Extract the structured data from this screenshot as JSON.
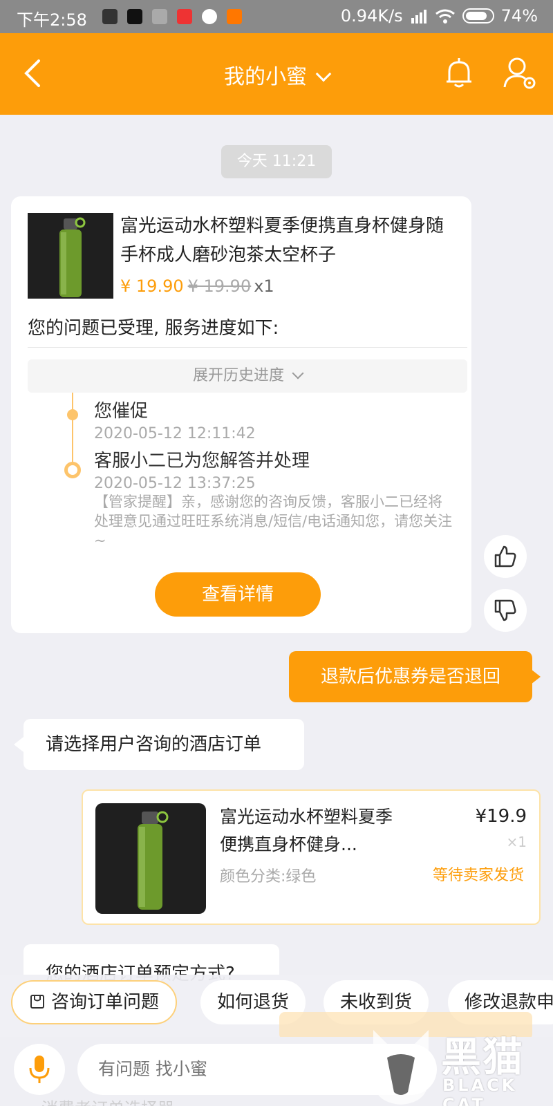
{
  "status_bar": {
    "time": "下午2:58",
    "network_speed": "0.94K/s",
    "battery": "74%"
  },
  "header": {
    "title": "我的小蜜"
  },
  "chat": {
    "timestamp": "今天 11:21",
    "service_card": {
      "product_title": "富光运动水杯塑料夏季便携直身杯健身随手杯成人磨砂泡茶太空杯子",
      "price": "¥ 19.90",
      "original_price": "¥ 19.90",
      "quantity": "x1",
      "accepted_text": "您的问题已受理, 服务进度如下:",
      "history_toggle": "展开历史进度",
      "timeline": [
        {
          "title": "您催促",
          "time": "2020-05-12 12:11:42"
        },
        {
          "title": "客服小二已为您解答并处理",
          "time": "2020-05-12 13:37:25",
          "note": "【管家提醒】亲，感谢您的咨询反馈，客服小二已经将处理意见通过旺旺系统消息/短信/电话通知您，请您关注~"
        }
      ],
      "detail_button": "查看详情"
    },
    "user_message": "退款后优惠券是否退回",
    "bot_message": "请选择用户咨询的酒店订单",
    "order_card": {
      "title": "富光运动水杯塑料夏季便携直身杯健身...",
      "spec": "颜色分类:绿色",
      "price": "¥19.9",
      "quantity": "×1",
      "status": "等待卖家发货"
    },
    "bot_message_2": "您的酒店订单预定方式?"
  },
  "quick_actions": [
    {
      "label": "咨询订单问题"
    },
    {
      "label": "如何退货"
    },
    {
      "label": "未收到货"
    },
    {
      "label": "修改退款申"
    }
  ],
  "input": {
    "placeholder": "有问题 找小蜜"
  },
  "bottom_text": "消费者订单选择器",
  "watermark": {
    "text": "黑猫",
    "sub": "BLACK CAT"
  },
  "colors": {
    "accent": "#fd9d0a",
    "background": "#efeff4"
  }
}
